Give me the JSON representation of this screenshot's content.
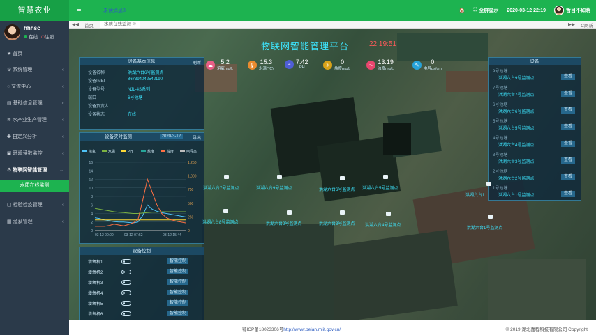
{
  "brand": "智慧农业",
  "topbar": {
    "menu_icon": "≡",
    "message": "未读消息3",
    "fullscreen": "全屏显示",
    "datetime": "2020-03-12 22:19",
    "username": "哲目不如萌"
  },
  "user": {
    "name": "hhhsc",
    "online": "在线",
    "logout": "注销"
  },
  "sidebar": {
    "items": [
      {
        "label": "首页",
        "icon": "★"
      },
      {
        "label": "系统管理",
        "icon": "⚙"
      },
      {
        "label": "交流中心",
        "icon": "◌"
      },
      {
        "label": "基础信息管理",
        "icon": "▤"
      },
      {
        "label": "水产业生产管理",
        "icon": "≋"
      },
      {
        "label": "自定义分析",
        "icon": "✚"
      },
      {
        "label": "环境读数监控",
        "icon": "▣"
      },
      {
        "label": "物联网智能管理",
        "icon": "⚙"
      },
      {
        "label": "检验检疫管理",
        "icon": "▢"
      },
      {
        "label": "渔获管理",
        "icon": "▦"
      }
    ],
    "sub_active": "水质在线监测"
  },
  "tabs": {
    "back": "◀◀",
    "home": "首页",
    "active": "水质在线监测",
    "forward": "▶▶",
    "refresh": "C刷新"
  },
  "platform": {
    "title": "物联网智能管理平台",
    "time": "22:19:51"
  },
  "metrics": [
    {
      "value": "5.2",
      "label": "溶氧mg/L",
      "color": "#e85f86",
      "icon": "☁"
    },
    {
      "value": "15.3",
      "label": "水温(℃)",
      "color": "#e98b2f",
      "icon": "🌡"
    },
    {
      "value": "7.42",
      "label": "PH",
      "color": "#4f5ed6",
      "icon": "≈"
    },
    {
      "value": "0",
      "label": "盐度mg/L",
      "color": "#d9a319",
      "icon": "☀"
    },
    {
      "value": "13.19",
      "label": "浊度mg/L",
      "color": "#e8466e",
      "icon": "〜"
    },
    {
      "value": "0",
      "label": "电导μs/cm",
      "color": "#27a3d9",
      "icon": "✎"
    }
  ],
  "basic_info": {
    "title": "设备基本信息",
    "refresh": "刷新",
    "rows": [
      {
        "k": "设备名称",
        "v": "洪湖六台6号监测点"
      },
      {
        "k": "设备IMEI",
        "v": "867394042542190"
      },
      {
        "k": "设备型号",
        "v": "NJL-4S系列"
      },
      {
        "k": "端口",
        "v": "6号池塘"
      },
      {
        "k": "设备负责人",
        "v": ""
      },
      {
        "k": "设备状态",
        "v": "在线"
      }
    ]
  },
  "realtime": {
    "title": "设备实时监测",
    "date": "2020-3-12",
    "export": "导出"
  },
  "chart_data": {
    "type": "line",
    "series": [
      {
        "name": "溶氧",
        "color": "#4fc3f7",
        "values": [
          3,
          2.8,
          2.5,
          2.3,
          2.1,
          2.0,
          2.0,
          1.9,
          1.8,
          2.0,
          3.5,
          6.0,
          5.0,
          4.5,
          4.2,
          4.0,
          3.8,
          3.6,
          3.4,
          3.2
        ]
      },
      {
        "name": "水温",
        "color": "#7cb342",
        "values": [
          5.2,
          5.0,
          4.8,
          4.6,
          4.4,
          4.3,
          4.2,
          4.1,
          4.0,
          4.0,
          4.1,
          4.2,
          4.3,
          4.3,
          4.4,
          4.4,
          4.4,
          4.4,
          4.4,
          4.4
        ]
      },
      {
        "name": "PH",
        "color": "#fdd835",
        "values": [
          2.5,
          2.5,
          2.5,
          2.5,
          2.5,
          2.5,
          2.5,
          2.5,
          2.5,
          2.5,
          2.5,
          2.5,
          2.5,
          2.5,
          2.5,
          2.5,
          2.5,
          2.5,
          2.5,
          2.5
        ]
      },
      {
        "name": "盐度",
        "color": "#26a69a",
        "values": [
          0,
          0,
          0,
          0,
          0,
          0,
          0,
          0,
          0,
          0,
          0,
          0,
          0,
          0,
          0,
          0,
          0,
          0,
          0,
          0
        ]
      },
      {
        "name": "浊度",
        "color": "#ff7043",
        "values": [
          1,
          1,
          1,
          1.2,
          1.5,
          1.3,
          1.1,
          1.4,
          1.8,
          2.5,
          7,
          12,
          9,
          6,
          4,
          3,
          2.5,
          2.2,
          2,
          1.8
        ]
      },
      {
        "name": "电导率",
        "color": "#bdbdbd",
        "values": [
          0,
          0,
          0,
          0,
          0,
          0,
          0,
          0,
          0,
          0,
          0,
          0,
          0,
          0,
          0,
          0,
          0,
          0,
          0,
          0
        ]
      }
    ],
    "x_ticks": [
      "03-12 00:00",
      "03-12 07:52",
      "03-12 15:44"
    ],
    "y_left_ticks": [
      "0",
      "2",
      "4",
      "6",
      "8",
      "10",
      "12",
      "14",
      "16"
    ],
    "y_right_ticks": [
      "0",
      "250",
      "500",
      "750",
      "1,000",
      "1,250"
    ],
    "ylim": [
      0,
      16
    ]
  },
  "device_control": {
    "title": "设备控制",
    "rows": [
      {
        "name": "增氧机1",
        "action": "智能控制"
      },
      {
        "name": "增氧机2",
        "action": "智能控制"
      },
      {
        "name": "增氧机3",
        "action": "智能控制"
      },
      {
        "name": "增氧机4",
        "action": "智能控制"
      },
      {
        "name": "增氧机5",
        "action": "智能控制"
      },
      {
        "name": "增氧机6",
        "action": "智能控制"
      }
    ]
  },
  "device_list": {
    "title": "设备",
    "rows": [
      {
        "pond": "9号池塘",
        "name": "洪湖六台9号监测点",
        "btn": "查看"
      },
      {
        "pond": "7号池塘",
        "name": "洪湖六台7号监测点",
        "btn": "查看"
      },
      {
        "pond": "6号池塘",
        "name": "洪湖六台6号监测点",
        "btn": "查看"
      },
      {
        "pond": "5号池塘",
        "name": "洪湖六台5号监测点",
        "btn": "查看"
      },
      {
        "pond": "4号池塘",
        "name": "洪湖六台4号监测点",
        "btn": "查看"
      },
      {
        "pond": "3号池塘",
        "name": "洪湖六台3号监测点",
        "btn": "查看"
      },
      {
        "pond": "2号池塘",
        "name": "洪湖六台2号监测点",
        "btn": "查看"
      },
      {
        "pond": "1号池塘",
        "name": "洪湖六台1号监测点",
        "btn": "查看"
      }
    ]
  },
  "map_labels": [
    "洪湖六台7号监测点",
    "洪湖六台9号监测点",
    "洪湖六台6号监测点",
    "洪湖六台5号监测点",
    "洪湖六台1",
    "洪湖六台2号监测点",
    "洪湖六台3号监测点",
    "洪湖六台1号监测点",
    "洪湖六台4号监测点",
    "洪湖六台8号监测点"
  ],
  "footer": {
    "icp": "鄂ICP备18023306号",
    "link": "http://www.beian.miit.gov.cn/",
    "copyright": "© 2019 湖北嘉程科技有限公司 Copyright"
  }
}
